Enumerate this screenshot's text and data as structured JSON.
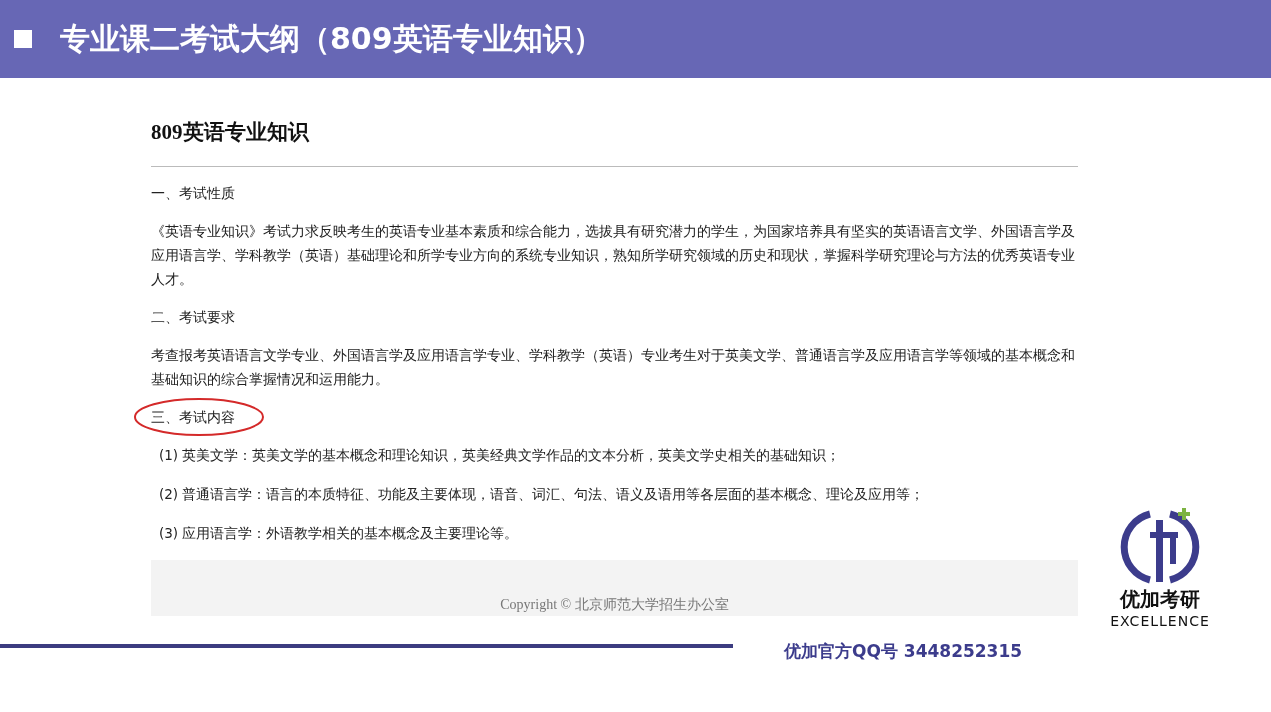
{
  "slide": {
    "title": "专业课二考试大纲（809英语专业知识）"
  },
  "page": {
    "heading": "809英语专业知识",
    "sections": [
      {
        "heading": "一、考试性质",
        "circled": false,
        "kind": "text",
        "paragraphs": [
          "《英语专业知识》考试力求反映考生的英语专业基本素质和综合能力，选拔具有研究潜力的学生，为国家培养具有坚实的英语语言文学、外国语言学及应用语言学、学科教学（英语）基础理论和所学专业方向的系统专业知识，熟知所学研究领域的历史和现状，掌握科学研究理论与方法的优秀英语专业人才。"
        ]
      },
      {
        "heading": "二、考试要求",
        "circled": false,
        "kind": "text",
        "paragraphs": [
          "考查报考英语语言文学专业、外国语言学及应用语言学专业、学科教学（英语）专业考生对于英美文学、普通语言学及应用语言学等领域的基本概念和基础知识的综合掌握情况和运用能力。"
        ]
      },
      {
        "heading": "三、考试内容",
        "circled": true,
        "kind": "list",
        "paragraphs": [
          "(1) 英美文学：英美文学的基本概念和理论知识，英美经典文学作品的文本分析，英美文学史相关的基础知识；",
          "(2) 普通语言学：语言的本质特征、功能及主要体现，语音、词汇、句法、语义及语用等各层面的基本概念、理论及应用等；",
          "(3) 应用语言学：外语教学相关的基本概念及主要理论等。"
        ]
      }
    ],
    "copyright": "Copyright © 北京师范大学招生办公室"
  },
  "brand": {
    "qq_line": "优加官方QQ号  3448252315",
    "logo_name": "优加考研",
    "logo_tagline": "EXCELLENCE"
  }
}
